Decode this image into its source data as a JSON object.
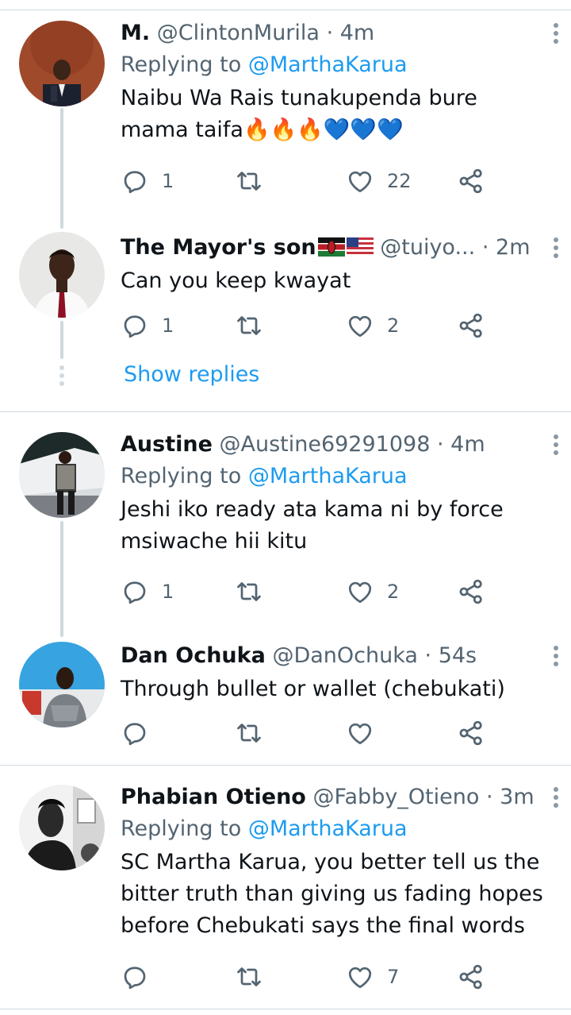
{
  "tweets": [
    {
      "name": "M.",
      "handle": "@ClintonMurila",
      "sep": "·",
      "time": "4m",
      "replying_prefix": "Replying to",
      "replying_to": "@MarthaKarua",
      "text": "Naibu Wa Rais tunakupenda bure mama taifa🔥🔥🔥💙💙💙",
      "reply_count": "1",
      "like_count": "22"
    },
    {
      "name": "The Mayor's son",
      "handle": "@tuiyo...",
      "sep": "·",
      "time": "2m",
      "text": "Can you keep kwayat",
      "reply_count": "1",
      "like_count": "2"
    },
    {
      "name": "Austine",
      "handle": "@Austine69291098",
      "sep": "·",
      "time": "4m",
      "replying_prefix": "Replying to",
      "replying_to": "@MarthaKarua",
      "text": "Jeshi iko ready ata kama ni by force msiwache hii kitu",
      "reply_count": "1",
      "like_count": "2"
    },
    {
      "name": "Dan Ochuka",
      "handle": "@DanOchuka",
      "sep": "·",
      "time": "54s",
      "text": "Through bullet or wallet (chebukati)",
      "reply_count": "",
      "like_count": ""
    },
    {
      "name": "Phabian Otieno",
      "handle": "@Fabby_Otieno",
      "sep": "·",
      "time": "3m",
      "replying_prefix": "Replying to",
      "replying_to": "@MarthaKarua",
      "text": "SC Martha Karua, you better tell us the bitter truth than giving us fading hopes before Chebukati says the final words",
      "reply_count": "",
      "like_count": "7"
    }
  ],
  "show_replies_label": "Show replies",
  "icons": {
    "reply": "reply-icon",
    "retweet": "retweet-icon",
    "like": "heart-icon",
    "share": "share-icon",
    "more": "more-vertical-icon",
    "flags": [
      "kenya-flag-icon",
      "us-flag-icon"
    ]
  },
  "colors": {
    "accent": "#1d9bf0",
    "secondary_text": "#536471",
    "divider": "#cfd9de"
  }
}
